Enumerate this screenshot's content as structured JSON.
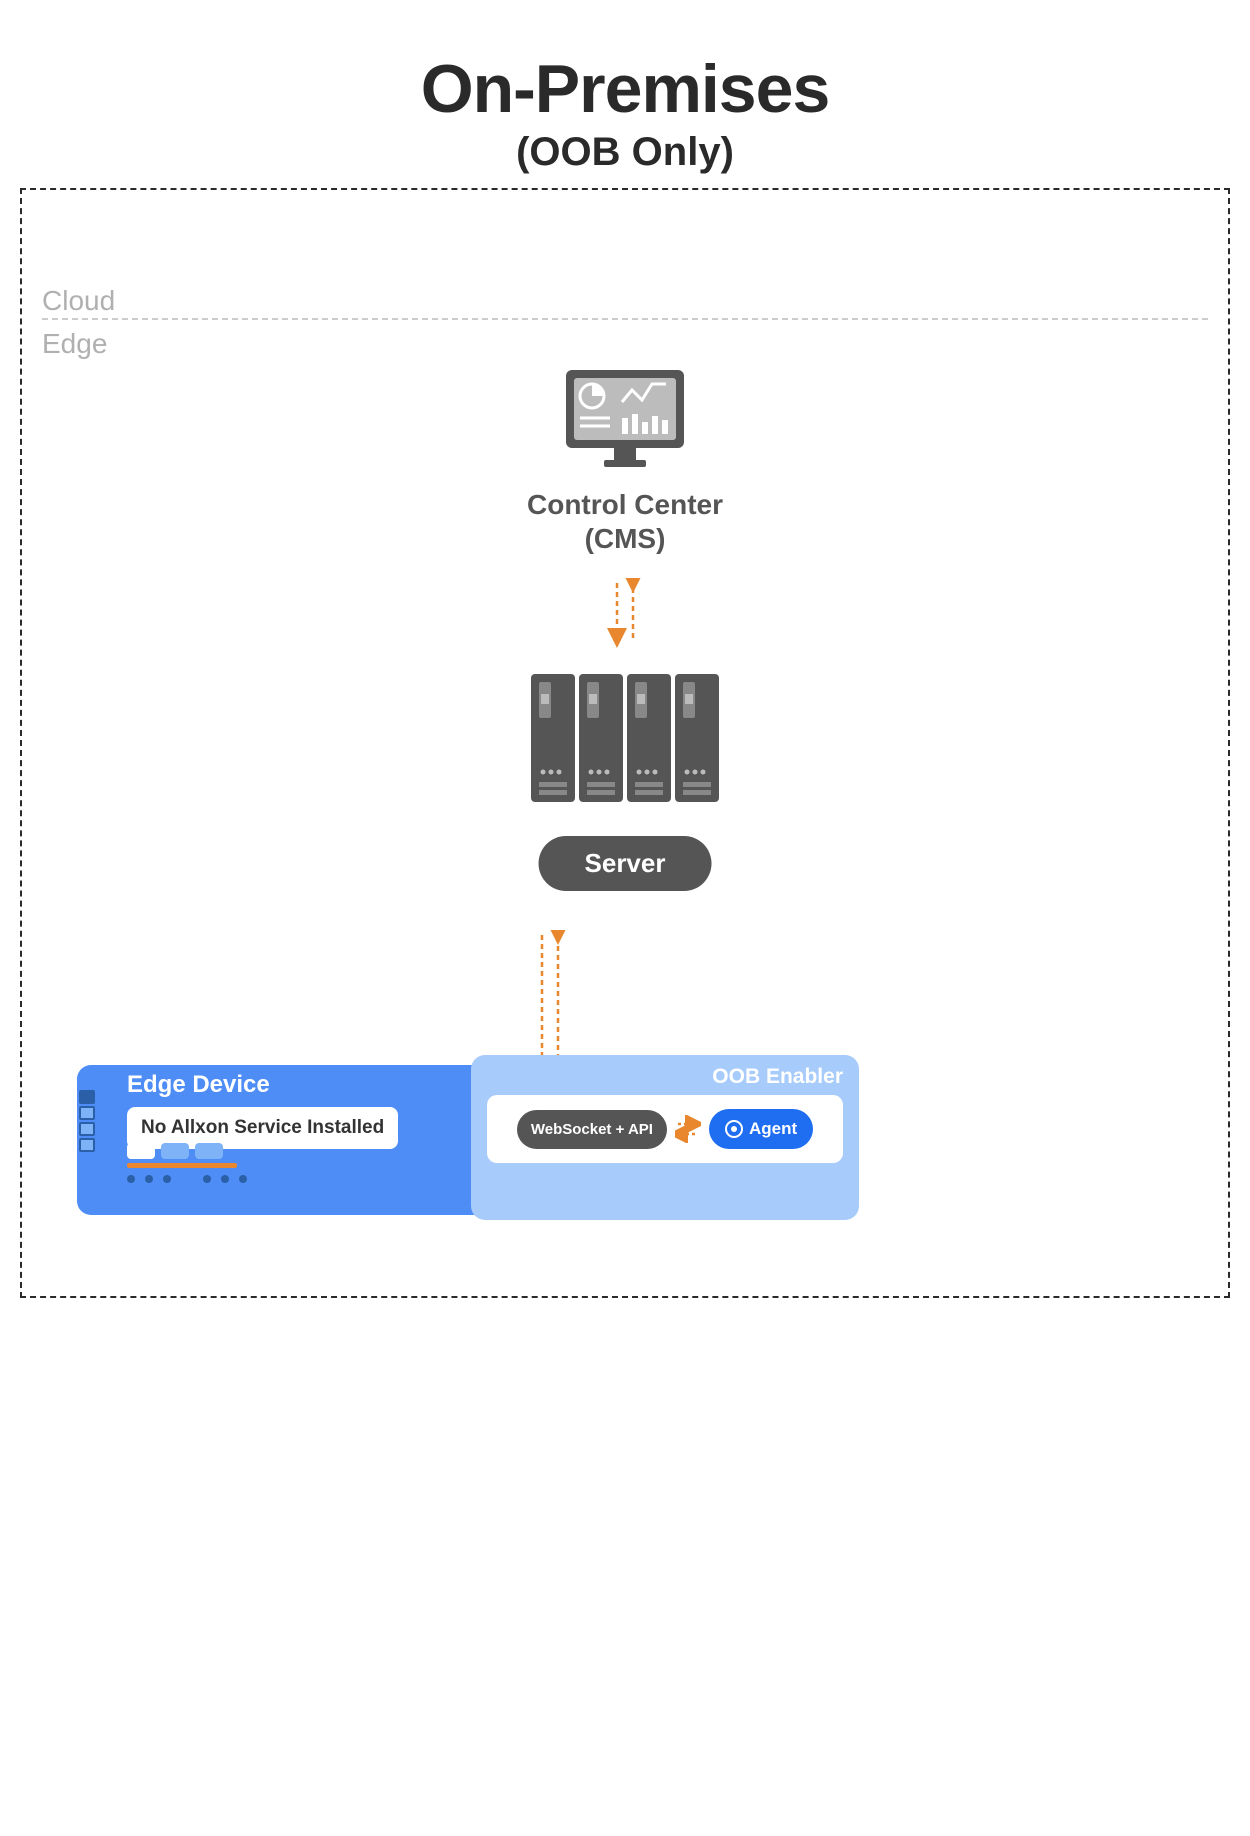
{
  "title": "On-Premises",
  "subtitle": "(OOB Only)",
  "zones": {
    "cloud": "Cloud",
    "edge": "Edge"
  },
  "control_center": {
    "line1": "Control Center",
    "line2": "(CMS)"
  },
  "server_label": "Server",
  "edge_device": {
    "title": "Edge Device",
    "badge": "No Allxon Service Installed"
  },
  "oob_enabler": {
    "title": "OOB Enabler",
    "websocket": "WebSocket + API",
    "agent": "Agent"
  },
  "colors": {
    "accent_orange": "#e8872e",
    "blue_main": "#4d8df5",
    "blue_light": "#a7cbfa",
    "blue_agent": "#1f6df0",
    "gray_dark": "#555"
  }
}
